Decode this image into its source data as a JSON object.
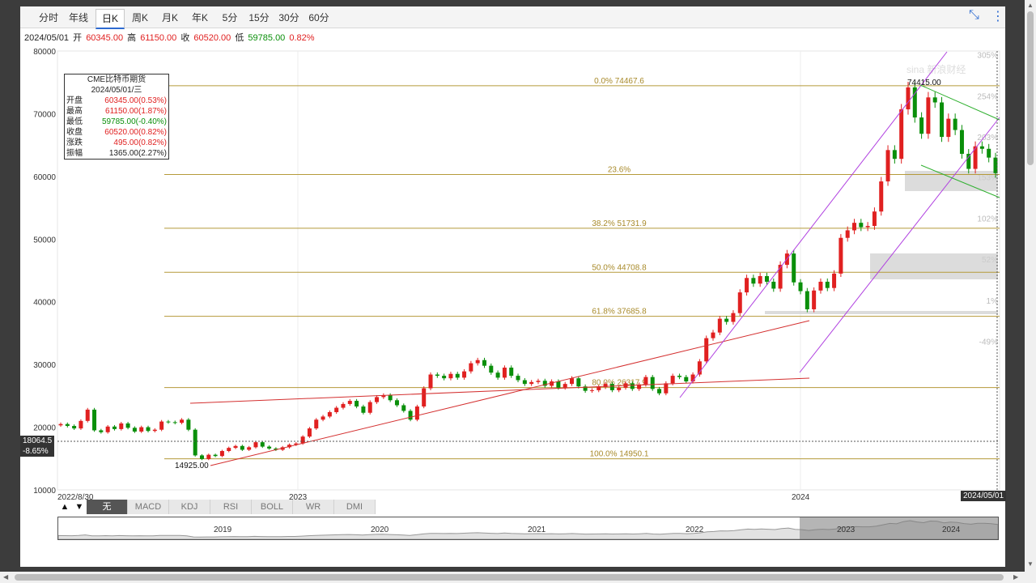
{
  "tabs": [
    "分时",
    "年线",
    "日K",
    "周K",
    "月K",
    "年K",
    "5分",
    "15分",
    "30分",
    "60分"
  ],
  "active_tab": "日K",
  "quote": {
    "date": "2024/05/01",
    "open_label": "开",
    "open": "60345.00",
    "high_label": "高",
    "high": "61150.00",
    "close_label": "收",
    "close": "60520.00",
    "low_label": "低",
    "low": "59785.00",
    "change": "0.82%"
  },
  "info": {
    "title": "CME比特币期货",
    "date": "2024/05/01/三",
    "rows": [
      {
        "label": "开盘",
        "value": "60345.00(0.53%)",
        "color": "#e02020"
      },
      {
        "label": "最高",
        "value": "61150.00(1.87%)",
        "color": "#e02020"
      },
      {
        "label": "最低",
        "value": "59785.00(-0.40%)",
        "color": "#0a8f0a"
      },
      {
        "label": "收盘",
        "value": "60520.00(0.82%)",
        "color": "#e02020"
      },
      {
        "label": "涨跌",
        "value": "495.00(0.82%)",
        "color": "#e02020"
      },
      {
        "label": "振幅",
        "value": "1365.00(2.27%)",
        "color": "#222222"
      }
    ]
  },
  "indicators": [
    "无",
    "MACD",
    "KDJ",
    "RSI",
    "BOLL",
    "WR",
    "DMI"
  ],
  "nav_years": [
    "2019",
    "2020",
    "2021",
    "2022",
    "2023",
    "2024"
  ],
  "cursor": {
    "price": "18064.5",
    "pct": "-8.65%",
    "date": "2024/05/01"
  },
  "watermark": "sina 新浪财经",
  "chart_data": {
    "type": "candlestick",
    "y_ticks": [
      10000,
      20000,
      30000,
      40000,
      50000,
      60000,
      70000,
      80000
    ],
    "ylim": [
      10000,
      80000
    ],
    "x_labels": [
      "2022/8/30",
      "2023",
      "2024"
    ],
    "right_pct_labels": [
      "305%",
      "254%",
      "203%",
      "153%",
      "102%",
      "52%",
      "1%",
      "-49%"
    ],
    "fib_levels": [
      {
        "label": "0.0% 74467.6",
        "value": 74467.6
      },
      {
        "label": "23.6%",
        "value": 60300
      },
      {
        "label": "38.2% 51731.9",
        "value": 51731.9
      },
      {
        "label": "50.0% 44708.8",
        "value": 44708.8
      },
      {
        "label": "61.8% 37685.8",
        "value": 37685.8
      },
      {
        "label": "80.0% 26317.9",
        "value": 26317.9
      },
      {
        "label": "100.0% 14950.1",
        "value": 14950.1
      }
    ],
    "annotations": [
      "74415.00",
      "14925.00"
    ],
    "series": [
      {
        "name": "CME比特币期货",
        "points": [
          20500,
          20200,
          19800,
          21000,
          22800,
          19500,
          19200,
          20100,
          19700,
          20600,
          19900,
          19300,
          20000,
          19400,
          19600,
          20900,
          20800,
          20700,
          21200,
          19600,
          15500,
          14925,
          15600,
          15400,
          16200,
          16700,
          17000,
          16400,
          16800,
          17600,
          16900,
          16600,
          16400,
          16800,
          17200,
          17400,
          18500,
          19800,
          21200,
          21700,
          22400,
          23100,
          23700,
          24200,
          23300,
          22300,
          24000,
          24800,
          25100,
          24300,
          23500,
          22600,
          21200,
          23300,
          26200,
          28400,
          28200,
          27800,
          28500,
          27900,
          28900,
          30200,
          30700,
          29800,
          28700,
          27900,
          29500,
          28200,
          27500,
          26900,
          27200,
          27400,
          26600,
          27300,
          26300,
          26900,
          27800,
          26500,
          25800,
          25900,
          26400,
          26900,
          25900,
          26300,
          27000,
          26100,
          26800,
          28000,
          26100,
          25400,
          27000,
          28200,
          28000,
          27300,
          28400,
          30500,
          34200,
          35100,
          37300,
          36800,
          38200,
          41500,
          43800,
          42900,
          44100,
          43200,
          42100,
          45900,
          47700,
          43100,
          41700,
          38800,
          41800,
          43200,
          42200,
          44500,
          50200,
          51400,
          52600,
          51900,
          52100,
          54400,
          59200,
          64200,
          62800,
          70700,
          74200,
          69400,
          66800,
          72600,
          71800,
          66300,
          69200,
          67400,
          63600,
          61200,
          64800,
          64400,
          63000,
          60520
        ]
      }
    ]
  }
}
